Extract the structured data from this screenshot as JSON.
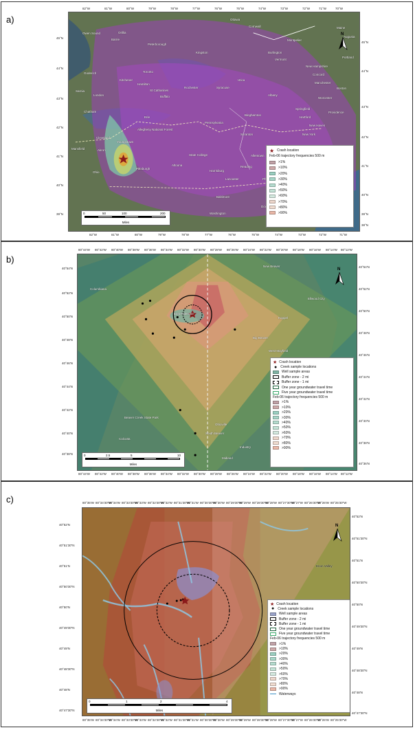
{
  "panels": {
    "a": {
      "label": "a)",
      "legend": {
        "crash": "Crash location",
        "title": "Feb-06 trajectory frequencies  500 m",
        "bins": [
          ">1%",
          ">10%",
          ">20%",
          ">30%",
          ">40%",
          ">50%",
          ">60%",
          ">70%",
          ">80%",
          ">90%"
        ]
      },
      "scale": {
        "ticks": [
          "0",
          "50",
          "100",
          "200"
        ],
        "unit": "Miles"
      },
      "lon_top": [
        "82°W",
        "81°W",
        "80°W",
        "79°W",
        "78°W",
        "77°W",
        "76°W",
        "75°W",
        "74°W",
        "73°W",
        "72°W",
        "71°W",
        "70°W"
      ],
      "lon_bottom": [
        "82°W",
        "81°W",
        "80°W",
        "79°W",
        "78°W",
        "77°W",
        "76°W",
        "75°W",
        "74°W",
        "73°W",
        "72°W",
        "71°W"
      ],
      "lat_left": [
        "45°N",
        "44°N",
        "43°N",
        "42°N",
        "41°N",
        "40°N",
        "39°N"
      ],
      "lat_right": [
        "45°N",
        "44°N",
        "43°N",
        "42°N",
        "41°N",
        "40°N",
        "39°N",
        "38°N"
      ],
      "places": [
        "Owen Sound",
        "Barrie",
        "Orillia",
        "Peterborough",
        "Kingston",
        "Ottawa",
        "Cornwall",
        "Montpelier",
        "Augusta",
        "Portland",
        "Burlington",
        "Toronto",
        "Kitchener",
        "Hamilton",
        "Goderich",
        "London",
        "Sarnia",
        "Chatham",
        "St Catharines",
        "Buffalo",
        "Rochester",
        "Syracuse",
        "Utica",
        "Albany",
        "New Hampshire",
        "Vermont",
        "Maine",
        "Concord",
        "Manchester",
        "Boston",
        "Worcester",
        "Springfield",
        "Hartford",
        "Providence",
        "New Haven",
        "New York",
        "Pennsylvania",
        "Erie",
        "Cleveland",
        "Akron",
        "Youngstown",
        "Mansfield",
        "Pittsburgh",
        "Altoona",
        "State College",
        "Harrisburg",
        "Reading",
        "Allentown",
        "Scranton",
        "Binghamton",
        "Philadelphia",
        "Trenton",
        "Lancaster",
        "Baltimore",
        "Washington",
        "Dover",
        "Ohio",
        "New Jersey",
        "Allegheny National Forest"
      ]
    },
    "b": {
      "label": "b)",
      "legend": {
        "crash": "Crash location",
        "creek": "Creek sample locations",
        "well": "Well sample areas",
        "buffer2": "Buffer zone - 2 mi",
        "buffer1": "Buffer zone - 1 mi",
        "one_year": "One year groundwater travel time",
        "five_year": "Five year groundwater travel time",
        "title": "Feb-06 trajectory frequencies  500 m",
        "bins": [
          ">1%",
          ">10%",
          ">20%",
          ">30%",
          ">40%",
          ">50%",
          ">60%",
          ">70%",
          ">80%",
          ">90%"
        ]
      },
      "scale": {
        "ticks": [
          "0",
          "2.5",
          "5",
          "10"
        ],
        "unit": "Miles"
      },
      "lon_ticks": [
        "80°44'W",
        "80°42'W",
        "80°40'W",
        "80°38'W",
        "80°36'W",
        "80°34'W",
        "80°32'W",
        "80°30'W",
        "80°28'W",
        "80°26'W",
        "80°24'W",
        "80°22'W",
        "80°20'W",
        "80°18'W",
        "80°16'W",
        "80°14'W",
        "80°12'W"
      ],
      "lat_left": [
        "40°54'N",
        "40°52'N",
        "40°50'N",
        "40°48'N",
        "40°46'N",
        "40°44'N",
        "40°42'N",
        "40°40'N",
        "40°38'N"
      ],
      "lat_right": [
        "40°54'N",
        "40°52'N",
        "40°50'N",
        "40°48'N",
        "40°46'N",
        "40°44'N",
        "40°42'N",
        "40°40'N",
        "40°38'N",
        "40°36'N"
      ],
      "places": [
        "Columbiana",
        "East Palestine",
        "New Beaver",
        "Ellwood City",
        "Koppel",
        "Big Beaver",
        "West Mayfield",
        "Ohioville",
        "Calcutta",
        "Midland",
        "Industry",
        "Beaver Creek State Park",
        "South Beaver"
      ]
    },
    "c": {
      "label": "c)",
      "legend": {
        "crash": "Crash location",
        "creek": "Creek sample locations",
        "well": "Well sample areas",
        "buffer2": "Buffer zone - 2 mi",
        "buffer1": "Buffer zone - 1 mi",
        "one_year": "One year groundwater travel time",
        "five_year": "Five year groundwater travel time",
        "title": "Feb-06 trajectory frequencies  500 m",
        "bins": [
          ">1%",
          ">10%",
          ">20%",
          ">30%",
          ">40%",
          ">50%",
          ">60%",
          ">70%",
          ">80%",
          ">90%"
        ],
        "waterways": "Waterways"
      },
      "scale": {
        "ticks": [
          "0",
          "1",
          "2",
          "4"
        ],
        "unit": "Miles"
      },
      "lon_ticks": [
        "80°35'W",
        "80°34'30\"W",
        "80°34'W",
        "80°33'30\"W",
        "80°33'W",
        "80°32'30\"W",
        "80°32'W",
        "80°31'30\"W",
        "80°31'W",
        "80°30'30\"W",
        "80°30'W",
        "80°29'30\"W",
        "80°29'W",
        "80°28'30\"W",
        "80°28'W",
        "80°27'30\"W",
        "80°27'W",
        "80°26'30\"W",
        "80°26'W",
        "80°25'30\"W"
      ],
      "lat_left": [
        "40°52'N",
        "40°51'30\"N",
        "40°51'N",
        "40°50'30\"N",
        "40°50'N",
        "40°49'30\"N",
        "40°49'N",
        "40°48'30\"N",
        "40°48'N",
        "40°47'30\"N"
      ],
      "lat_right": [
        "40°52'N",
        "40°51'30\"N",
        "40°51'N",
        "40°50'30\"N",
        "40°50'N",
        "40°49'30\"N",
        "40°49'N",
        "40°48'30\"N",
        "40°48'N",
        "40°47'30\"N"
      ],
      "places": [
        "Enon Valley"
      ]
    }
  },
  "colors": {
    "bins": [
      "#c2a3a8",
      "#cda9a9",
      "#9bd0c2",
      "#a7d6c8",
      "#b5dccf",
      "#c3e2d6",
      "#d4e9df",
      "#ecd6cb",
      "#f0dcd0",
      "#e9b7a7"
    ],
    "purple": "#9b3fb8",
    "crash": "#8b1a1a",
    "well": "#9aa3c9"
  }
}
